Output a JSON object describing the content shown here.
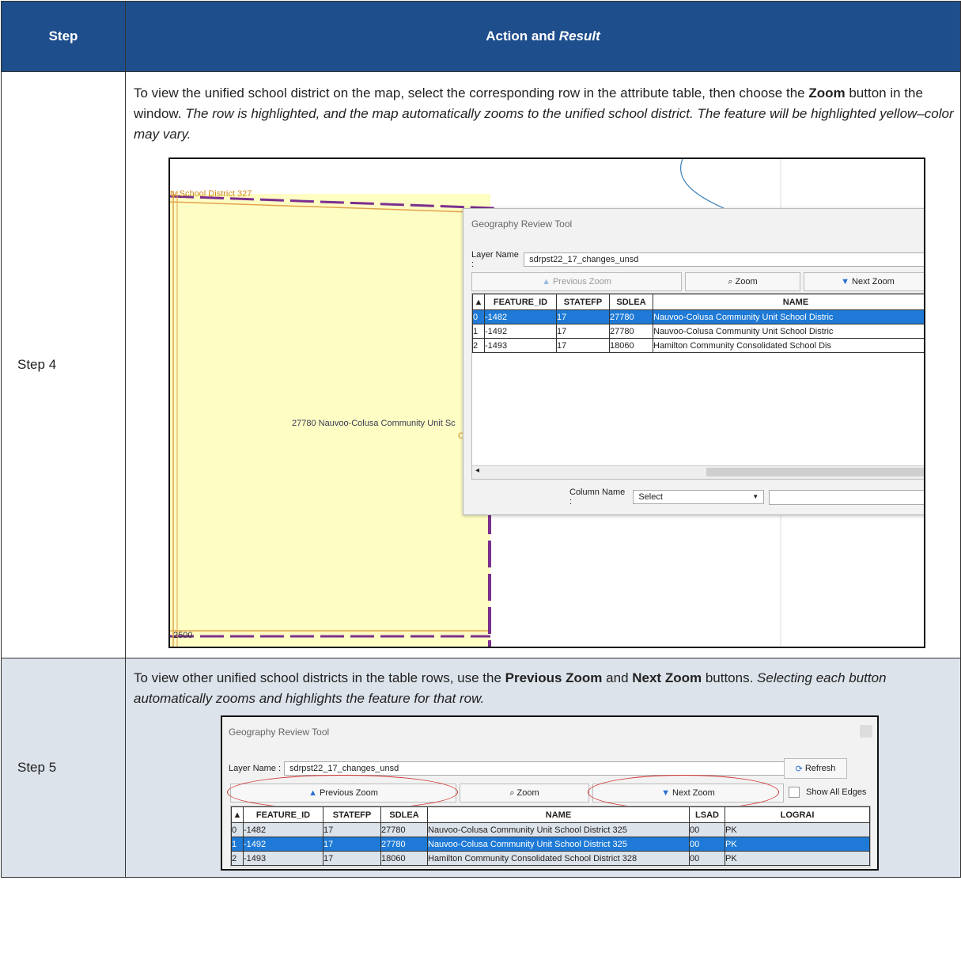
{
  "header": {
    "step": "Step",
    "action_a": "Action and ",
    "action_b": "Result"
  },
  "step4": {
    "label": "Step 4",
    "t1": "To view the unified school district on the map, select the corresponding row in the attribute table, then choose the ",
    "t2": "Zoom",
    "t3": " button in the window. ",
    "t4": "The row is highlighted, and the map automatically zooms to the unified school district. The feature will be highlighted yellow–color may vary.",
    "map": {
      "label_top": "ty School District 327",
      "label_mid": "27780 Nauvoo-Colusa Community Unit Sc",
      "label_c": "C",
      "label_bottom": "2500"
    },
    "window": {
      "title": "Geography Review Tool",
      "layer_label": "Layer Name :",
      "layer_value": "sdrpst22_17_changes_unsd",
      "prev": "Previous Zoom",
      "zoom": "Zoom",
      "next": "Next Zoom",
      "sort_arrow": "▲",
      "columns": [
        "FEATURE_ID",
        "STATEFP",
        "SDLEA",
        "NAME"
      ],
      "rows": [
        [
          "0",
          "-1482",
          "17",
          "27780",
          "Nauvoo-Colusa Community Unit School Distric"
        ],
        [
          "1",
          "-1492",
          "17",
          "27780",
          "Nauvoo-Colusa Community Unit School Distric"
        ],
        [
          "2",
          "-1493",
          "17",
          "18060",
          "Hamilton Community Consolidated School Dis"
        ]
      ],
      "selected_row": 0,
      "scroll_left": "◂",
      "column_name_label": "Column Name :",
      "column_name_value": "Select"
    }
  },
  "step5": {
    "label": "Step 5",
    "t1": "To view other unified school districts in the table rows, use the ",
    "t2": "Previous Zoom",
    "t3": " and ",
    "t4": "Next Zoom",
    "t5": " buttons. ",
    "t6": "Selecting each button automatically zooms and highlights the feature for that row.",
    "window": {
      "title": "Geography Review Tool",
      "layer_label": "Layer Name :",
      "layer_value": "sdrpst22_17_changes_unsd",
      "refresh": "Refresh",
      "prev": "Previous Zoom",
      "zoom": "Zoom",
      "next": "Next Zoom",
      "show_all": "Show All Edges",
      "sort_arrow": "▲",
      "columns": [
        "FEATURE_ID",
        "STATEFP",
        "SDLEA",
        "NAME",
        "LSAD",
        "LOGRAI"
      ],
      "rows": [
        [
          "0",
          "-1482",
          "17",
          "27780",
          "Nauvoo-Colusa Community Unit School District 325",
          "00",
          "PK"
        ],
        [
          "1",
          "-1492",
          "17",
          "27780",
          "Nauvoo-Colusa Community Unit School District 325",
          "00",
          "PK"
        ],
        [
          "2",
          "-1493",
          "17",
          "18060",
          "Hamilton Community Consolidated School District 328",
          "00",
          "PK"
        ]
      ],
      "selected_row": 1
    }
  }
}
